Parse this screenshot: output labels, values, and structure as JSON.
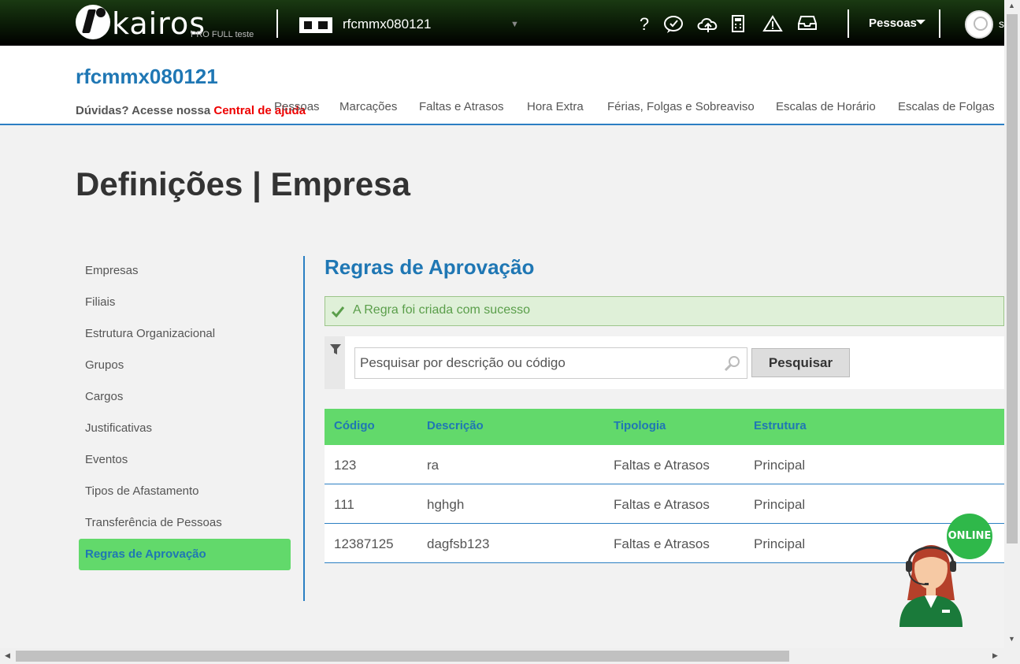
{
  "topbar": {
    "logo_text": "kairos",
    "logo_sub": "PRO FULL teste",
    "company": "rfcmmx080121",
    "people_menu": "Pessoas",
    "avatar_trunc": "s",
    "icons": [
      "help-icon",
      "chat-bubble-icon",
      "cloud-upload-icon",
      "calculator-icon",
      "warning-icon",
      "inbox-icon"
    ]
  },
  "header": {
    "title": "rfcmmx080121",
    "help_prefix": "Dúvidas? Acesse nossa ",
    "help_link": "Central de ajuda",
    "nav": [
      "Pessoas",
      "Marcações",
      "Faltas e Atrasos",
      "Hora Extra",
      "Férias, Folgas e Sobreaviso",
      "Escalas de Horário",
      "Escalas de Folgas"
    ]
  },
  "page": {
    "title": "Definições | Empresa"
  },
  "sidemenu": {
    "items": [
      "Empresas",
      "Filiais",
      "Estrutura Organizacional",
      "Grupos",
      "Cargos",
      "Justificativas",
      "Eventos",
      "Tipos de Afastamento",
      "Transferência de Pessoas",
      "Regras de Aprovação"
    ],
    "active": "Regras de Aprovação"
  },
  "main": {
    "section_title": "Regras de Aprovação",
    "alert": "A Regra foi criada com sucesso",
    "search": {
      "placeholder": "Pesquisar por descrição ou código",
      "button": "Pesquisar"
    },
    "table": {
      "headers": [
        "Código",
        "Descrição",
        "Tipologia",
        "Estrutura"
      ],
      "rows": [
        [
          "123",
          "ra",
          "Faltas e Atrasos",
          "Principal"
        ],
        [
          "111",
          "hghgh",
          "Faltas e Atrasos",
          "Principal"
        ],
        [
          "12387125",
          "dagfsb123",
          "Faltas e Atrasos",
          "Principal"
        ]
      ]
    }
  },
  "chat": {
    "badge": "ONLINE"
  },
  "colors": {
    "brand_blue": "#1f77b4",
    "green": "#62d96b",
    "alert_bg": "#dff0d8",
    "help_link": "#ee0000"
  }
}
